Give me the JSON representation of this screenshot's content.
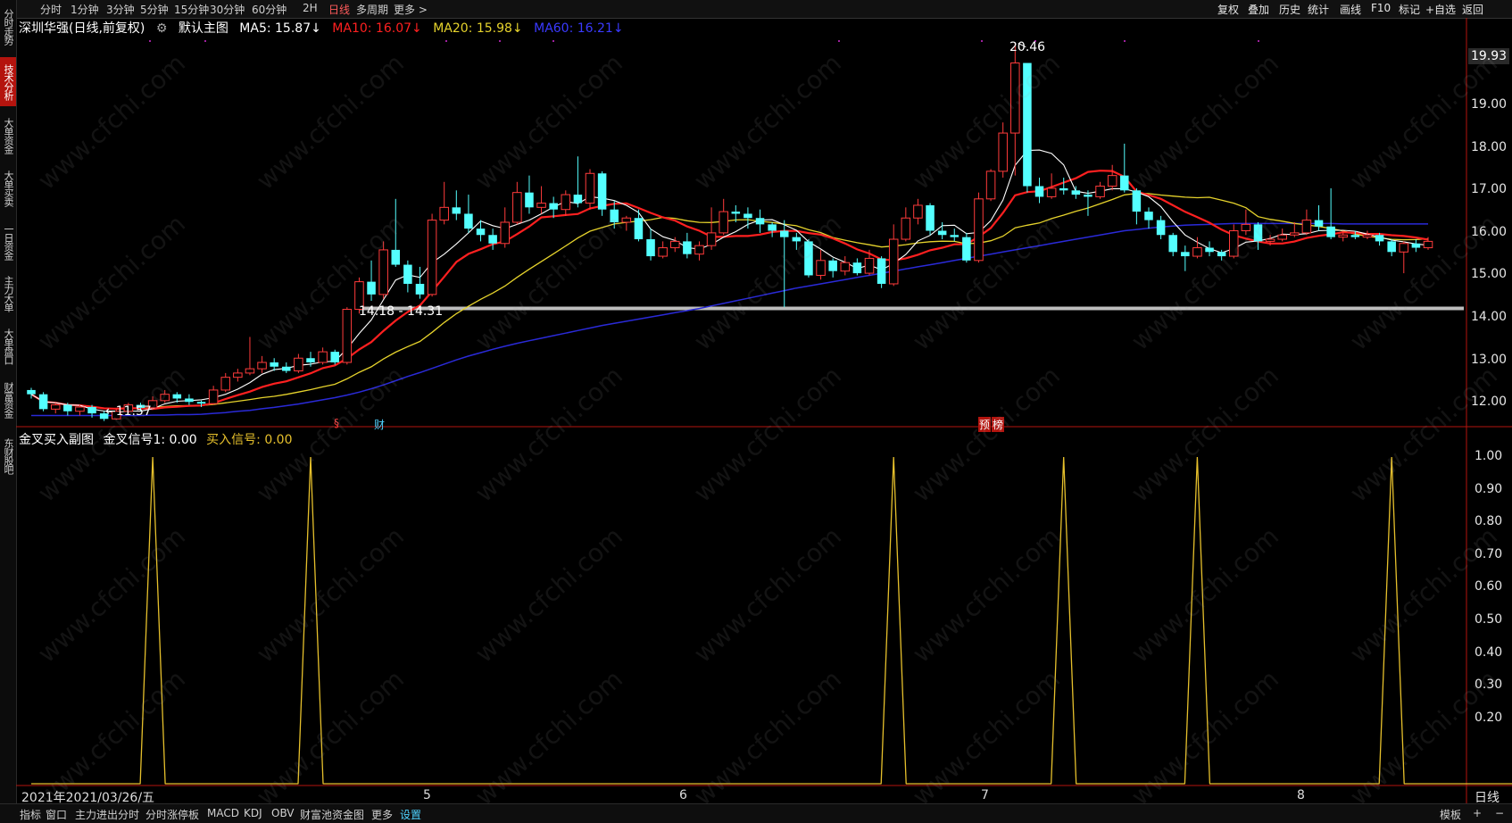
{
  "sidebar": {
    "tabs": [
      {
        "label": "分时走势",
        "active": false
      },
      {
        "label": "技术分析",
        "active": true
      },
      {
        "label": "大单资金",
        "active": false
      },
      {
        "label": "大单买卖",
        "active": false
      },
      {
        "label": "一日资金",
        "active": false
      },
      {
        "label": "主力大单",
        "active": false
      },
      {
        "label": "大单盘口",
        "active": false
      },
      {
        "label": "财富资金",
        "active": false
      },
      {
        "label": "东财股吧",
        "active": false
      }
    ]
  },
  "toolbar": {
    "periods": [
      "分时",
      "1分钟",
      "3分钟",
      "5分钟",
      "15分钟",
      "30分钟",
      "60分钟",
      "2H",
      "日线",
      "多周期",
      "更多 >"
    ],
    "active_period": "日线",
    "right_items": [
      "复权",
      "叠加",
      "历史",
      "统计",
      "画线",
      "F10",
      "标记",
      "+自选",
      "返回"
    ]
  },
  "main_legend": {
    "stock": "深圳华强(日线,前复权)",
    "template": "默认主图",
    "ma5": "MA5: 15.87↓",
    "ma10": "MA10: 16.07↓",
    "ma20": "MA20: 15.98↓",
    "ma60": "MA60: 16.21↓"
  },
  "sub_legend": {
    "title": "金叉买入副图",
    "signal1": "金叉信号1: 0.00",
    "buy": "买入信号: 0.00"
  },
  "price_axis": {
    "labels": [
      "19.00",
      "18.00",
      "17.00",
      "16.00",
      "15.00",
      "14.00",
      "13.00",
      "12.00"
    ],
    "current": "19.93"
  },
  "sub_axis": {
    "labels": [
      "1.00",
      "0.90",
      "0.80",
      "0.70",
      "0.60",
      "0.50",
      "0.40",
      "0.30",
      "0.20"
    ]
  },
  "annotations": {
    "high": "20.46",
    "low": "←11.57",
    "range": "14.18 - 14.31",
    "tag_s": "§",
    "tag_cai": "财",
    "tag_yu": "预",
    "tag_bang": "榜"
  },
  "date_axis": {
    "start": "2021年2021/03/26/五",
    "months": [
      "5",
      "6",
      "7",
      "8"
    ],
    "right_label": "日线"
  },
  "bottom_bar": {
    "items": [
      "指标",
      "窗口",
      "主力进出分时",
      "分时涨停板",
      "MACD",
      "KDJ",
      "OBV",
      "财富池资金图",
      "更多",
      "设置"
    ],
    "active": "设置",
    "right_items": [
      "模板",
      "+",
      "−"
    ]
  },
  "watermark": "www.cfchi.com",
  "colors": {
    "up": "#ff3b3b",
    "down": "#54ffff",
    "ma5": "#ffffff",
    "ma10": "#ff2020",
    "ma20": "#e6d32c",
    "ma60": "#2a2ad8",
    "signal": "#e6c02c"
  },
  "chart_data": [
    {
      "type": "candlestick",
      "title": "深圳华强(日线,前复权)",
      "ylim": [
        11.5,
        20.6
      ],
      "indicators": [
        "MA5",
        "MA10",
        "MA20",
        "MA60"
      ],
      "support_line": [
        14.18,
        14.31
      ],
      "high": 20.46,
      "low": 11.57,
      "candles": [
        [
          12.3,
          12.2,
          12.35,
          12.1
        ],
        [
          12.2,
          11.85,
          12.25,
          11.8
        ],
        [
          11.85,
          11.95,
          12.0,
          11.75
        ],
        [
          11.95,
          11.8,
          12.0,
          11.7
        ],
        [
          11.8,
          11.9,
          11.95,
          11.7
        ],
        [
          11.9,
          11.75,
          11.95,
          11.65
        ],
        [
          11.75,
          11.62,
          11.8,
          11.57
        ],
        [
          11.62,
          11.8,
          11.85,
          11.6
        ],
        [
          11.8,
          11.95,
          12.0,
          11.75
        ],
        [
          11.95,
          11.88,
          12.0,
          11.8
        ],
        [
          11.88,
          12.05,
          12.15,
          11.85
        ],
        [
          12.05,
          12.2,
          12.3,
          12.0
        ],
        [
          12.2,
          12.1,
          12.25,
          12.0
        ],
        [
          12.1,
          12.02,
          12.2,
          11.95
        ],
        [
          12.02,
          11.98,
          12.05,
          11.9
        ],
        [
          11.98,
          12.3,
          12.4,
          11.95
        ],
        [
          12.3,
          12.6,
          12.7,
          12.25
        ],
        [
          12.6,
          12.7,
          12.8,
          12.5
        ],
        [
          12.7,
          12.8,
          13.55,
          12.65
        ],
        [
          12.8,
          12.95,
          13.1,
          12.7
        ],
        [
          12.95,
          12.85,
          13.05,
          12.75
        ],
        [
          12.85,
          12.75,
          12.95,
          12.7
        ],
        [
          12.75,
          13.05,
          13.15,
          12.7
        ],
        [
          13.05,
          12.95,
          13.2,
          12.85
        ],
        [
          12.95,
          13.2,
          13.3,
          12.9
        ],
        [
          13.2,
          12.95,
          13.25,
          12.9
        ],
        [
          12.95,
          14.2,
          14.25,
          12.9
        ],
        [
          14.2,
          14.85,
          14.95,
          14.1
        ],
        [
          14.85,
          14.55,
          15.35,
          14.4
        ],
        [
          14.55,
          15.6,
          15.8,
          14.45
        ],
        [
          15.6,
          15.25,
          16.8,
          15.2
        ],
        [
          15.25,
          14.8,
          15.35,
          14.6
        ],
        [
          14.8,
          14.55,
          15.2,
          14.45
        ],
        [
          14.55,
          16.3,
          16.45,
          14.5
        ],
        [
          16.3,
          16.6,
          17.2,
          16.2
        ],
        [
          16.6,
          16.45,
          17.0,
          16.3
        ],
        [
          16.45,
          16.1,
          16.9,
          16.0
        ],
        [
          16.1,
          15.95,
          16.3,
          15.8
        ],
        [
          15.95,
          15.75,
          16.1,
          15.6
        ],
        [
          15.75,
          16.25,
          16.6,
          15.65
        ],
        [
          16.25,
          16.95,
          17.2,
          16.2
        ],
        [
          16.95,
          16.6,
          17.35,
          16.45
        ],
        [
          16.6,
          16.7,
          17.1,
          16.45
        ],
        [
          16.7,
          16.55,
          16.85,
          16.35
        ],
        [
          16.55,
          16.9,
          17.0,
          16.4
        ],
        [
          16.9,
          16.7,
          17.8,
          16.6
        ],
        [
          16.7,
          17.4,
          17.5,
          16.55
        ],
        [
          17.4,
          16.55,
          17.45,
          16.4
        ],
        [
          16.55,
          16.25,
          16.75,
          16.1
        ],
        [
          16.25,
          16.35,
          16.4,
          16.05
        ],
        [
          16.35,
          15.85,
          16.55,
          15.8
        ],
        [
          15.85,
          15.45,
          16.1,
          15.35
        ],
        [
          15.45,
          15.65,
          15.8,
          15.4
        ],
        [
          15.65,
          15.8,
          15.9,
          15.55
        ],
        [
          15.8,
          15.5,
          16.0,
          15.4
        ],
        [
          15.5,
          15.7,
          15.8,
          15.35
        ],
        [
          15.7,
          16.0,
          16.6,
          15.6
        ],
        [
          16.0,
          16.5,
          16.8,
          15.95
        ],
        [
          16.5,
          16.45,
          16.65,
          16.25
        ],
        [
          16.45,
          16.35,
          16.6,
          16.1
        ],
        [
          16.35,
          16.2,
          16.55,
          16.0
        ],
        [
          16.2,
          16.05,
          16.25,
          15.9
        ],
        [
          16.05,
          15.9,
          16.3,
          14.25
        ],
        [
          15.9,
          15.8,
          16.0,
          15.6
        ],
        [
          15.8,
          15.0,
          15.85,
          14.95
        ],
        [
          15.0,
          15.35,
          15.6,
          14.9
        ],
        [
          15.35,
          15.1,
          15.4,
          14.95
        ],
        [
          15.1,
          15.3,
          15.45,
          15.0
        ],
        [
          15.3,
          15.05,
          15.4,
          15.0
        ],
        [
          15.05,
          15.4,
          15.6,
          15.0
        ],
        [
          15.4,
          14.8,
          15.45,
          14.7
        ],
        [
          14.8,
          15.85,
          16.2,
          14.75
        ],
        [
          15.85,
          16.35,
          16.6,
          15.8
        ],
        [
          16.35,
          16.65,
          16.8,
          16.2
        ],
        [
          16.65,
          16.05,
          16.7,
          15.95
        ],
        [
          16.05,
          15.95,
          16.25,
          15.85
        ],
        [
          15.95,
          15.9,
          16.1,
          15.8
        ],
        [
          15.9,
          15.35,
          16.0,
          15.3
        ],
        [
          15.35,
          16.8,
          16.95,
          15.3
        ],
        [
          16.8,
          17.45,
          17.5,
          16.75
        ],
        [
          17.45,
          18.35,
          18.6,
          17.3
        ],
        [
          18.35,
          20.0,
          20.46,
          17.35
        ],
        [
          20.0,
          17.1,
          17.2,
          16.95
        ],
        [
          17.1,
          16.85,
          17.3,
          16.7
        ],
        [
          16.85,
          17.05,
          17.4,
          16.8
        ],
        [
          17.05,
          17.0,
          17.3,
          16.9
        ],
        [
          17.0,
          16.9,
          17.1,
          16.8
        ],
        [
          16.9,
          16.85,
          17.0,
          16.4
        ],
        [
          16.85,
          17.1,
          17.2,
          16.8
        ],
        [
          17.1,
          17.35,
          17.6,
          17.0
        ],
        [
          17.35,
          17.0,
          18.1,
          16.95
        ],
        [
          17.0,
          16.5,
          17.05,
          16.2
        ],
        [
          16.5,
          16.3,
          16.6,
          16.1
        ],
        [
          16.3,
          15.95,
          16.4,
          15.85
        ],
        [
          15.95,
          15.55,
          16.0,
          15.45
        ],
        [
          15.55,
          15.45,
          15.7,
          15.1
        ],
        [
          15.45,
          15.65,
          15.9,
          15.4
        ],
        [
          15.65,
          15.55,
          15.8,
          15.45
        ],
        [
          15.55,
          15.45,
          15.6,
          15.35
        ],
        [
          15.45,
          16.05,
          16.2,
          15.4
        ],
        [
          16.05,
          16.2,
          16.55,
          15.95
        ],
        [
          16.2,
          15.8,
          16.25,
          15.6
        ],
        [
          15.8,
          15.85,
          15.95,
          15.7
        ],
        [
          15.85,
          15.95,
          16.1,
          15.8
        ],
        [
          15.95,
          16.0,
          16.25,
          15.9
        ],
        [
          16.0,
          16.3,
          16.55,
          15.95
        ],
        [
          16.3,
          16.15,
          16.65,
          16.05
        ],
        [
          16.15,
          15.9,
          17.05,
          15.85
        ],
        [
          15.9,
          15.95,
          16.05,
          15.8
        ],
        [
          15.95,
          15.9,
          16.05,
          15.85
        ],
        [
          15.9,
          15.95,
          16.05,
          15.85
        ],
        [
          15.95,
          15.8,
          16.0,
          15.7
        ],
        [
          15.8,
          15.55,
          15.85,
          15.45
        ],
        [
          15.55,
          15.75,
          15.8,
          15.05
        ],
        [
          15.75,
          15.65,
          15.85,
          15.55
        ],
        [
          15.65,
          15.8,
          15.9,
          15.6
        ]
      ],
      "ma60": [
        11.7,
        11.7,
        11.7,
        11.7,
        11.7,
        11.7,
        11.7,
        11.7,
        11.7,
        11.7,
        11.71,
        11.71,
        11.72,
        11.72,
        11.73,
        11.75,
        11.77,
        11.8,
        11.82,
        11.86,
        11.89,
        11.93,
        11.97,
        12.02,
        12.07,
        12.12,
        12.18,
        12.25,
        12.33,
        12.42,
        12.52,
        12.62,
        12.71,
        12.81,
        12.91,
        13.01,
        13.1,
        13.18,
        13.26,
        13.33,
        13.4,
        13.46,
        13.52,
        13.58,
        13.64,
        13.7,
        13.76,
        13.82,
        13.87,
        13.92,
        13.97,
        14.02,
        14.07,
        14.12,
        14.17,
        14.22,
        14.28,
        14.34,
        14.4,
        14.46,
        14.52,
        14.58,
        14.64,
        14.7,
        14.75,
        14.8,
        14.85,
        14.9,
        14.95,
        15.0,
        15.05,
        15.1,
        15.15,
        15.2,
        15.25,
        15.3,
        15.35,
        15.4,
        15.45,
        15.5,
        15.55,
        15.6,
        15.65,
        15.7,
        15.75,
        15.8,
        15.85,
        15.9,
        15.95,
        16.0,
        16.05,
        16.08,
        16.11,
        16.14,
        16.16,
        16.18,
        16.19,
        16.2,
        16.21,
        16.22,
        16.22,
        16.22,
        16.22,
        16.22,
        16.22,
        16.22,
        16.22,
        16.22,
        16.21,
        16.21,
        16.21,
        16.21,
        16.21,
        16.21,
        16.21,
        16.21
      ]
    },
    {
      "type": "line",
      "title": "金叉买入副图",
      "ylim": [
        0,
        1.0
      ],
      "series": [
        {
          "name": "金叉信号1",
          "values": [
            0,
            0,
            0,
            0,
            0,
            0,
            0,
            0,
            0,
            0,
            1,
            0,
            0,
            0,
            0,
            0,
            0,
            0,
            0,
            0,
            0,
            0,
            0,
            1,
            0,
            0,
            0,
            0,
            0,
            0,
            0,
            0,
            0,
            0,
            0,
            0,
            0,
            0,
            0,
            0,
            0,
            0,
            0,
            0,
            0,
            0,
            0,
            0,
            0,
            0,
            0,
            0,
            0,
            0,
            0,
            0,
            0,
            0,
            0,
            0,
            0,
            0,
            0,
            0,
            0,
            0,
            0,
            0,
            0,
            0,
            0,
            1,
            0,
            0,
            0,
            0,
            0,
            0,
            0,
            0,
            0,
            0,
            0,
            0,
            0,
            1,
            0,
            0,
            0,
            0,
            0,
            0,
            0,
            0,
            0,
            0,
            1,
            0,
            0,
            0,
            0,
            0,
            0,
            0,
            0,
            0,
            0,
            0,
            0,
            0,
            0,
            0,
            1,
            0,
            0,
            0,
            0,
            0,
            0,
            0,
            0,
            0,
            0,
            0,
            0,
            0
          ]
        }
      ]
    }
  ]
}
